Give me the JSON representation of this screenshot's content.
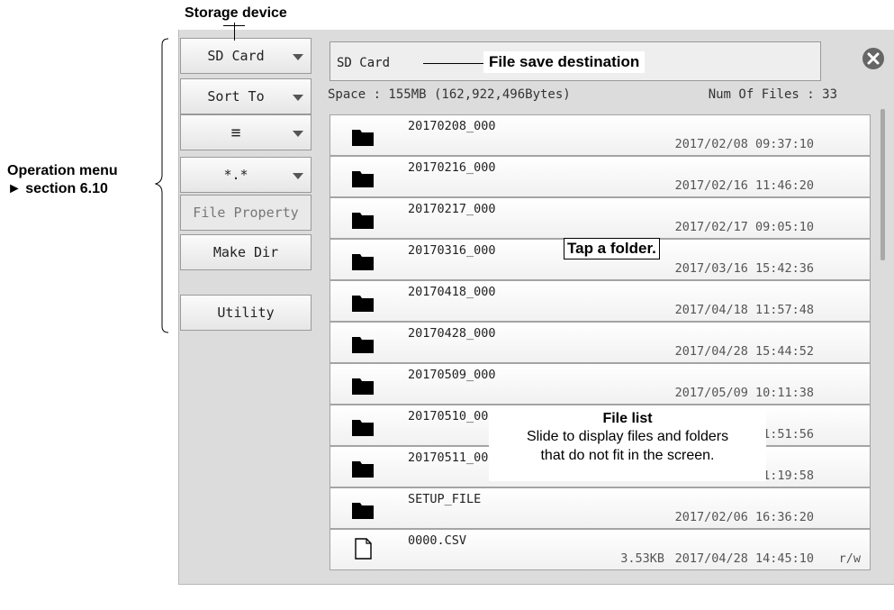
{
  "annotations": {
    "storage_device": "Storage device",
    "operation_menu_line1": "Operation menu",
    "operation_menu_line2": "► section 6.10",
    "file_save_destination": "File save destination",
    "tap_folder": "Tap a folder.",
    "file_list_title": "File list",
    "file_list_line1": "Slide to display files and folders",
    "file_list_line2": "that do not fit in the screen."
  },
  "menu": {
    "storage": "SD Card",
    "sort": "Sort To",
    "view": "≡",
    "filter": "*.*",
    "file_property": "File Property",
    "make_dir": "Make Dir",
    "utility": "Utility"
  },
  "destination": "SD Card",
  "space": "Space : 155MB (162,922,496Bytes)",
  "num_files": "Num Of Files : 33",
  "files": [
    {
      "name": "20170208_000",
      "date": "2017/02/08 09:37:10",
      "type": "folder"
    },
    {
      "name": "20170216_000",
      "date": "2017/02/16 11:46:20",
      "type": "folder"
    },
    {
      "name": "20170217_000",
      "date": "2017/02/17 09:05:10",
      "type": "folder"
    },
    {
      "name": "20170316_000",
      "date": "2017/03/16 15:42:36",
      "type": "folder"
    },
    {
      "name": "20170418_000",
      "date": "2017/04/18 11:57:48",
      "type": "folder"
    },
    {
      "name": "20170428_000",
      "date": "2017/04/28 15:44:52",
      "type": "folder"
    },
    {
      "name": "20170509_000",
      "date": "2017/05/09 10:11:38",
      "type": "folder"
    },
    {
      "name": "20170510_000",
      "date": "2017/05/10 11:51:56",
      "type": "folder"
    },
    {
      "name": "20170511_000",
      "date": "2017/05/11 11:19:58",
      "type": "folder"
    },
    {
      "name": "SETUP_FILE",
      "date": "2017/02/06 16:36:20",
      "type": "folder"
    },
    {
      "name": "0000.CSV",
      "date": "2017/04/28 14:45:10",
      "size": "3.53KB",
      "attr": "r/w",
      "type": "file"
    }
  ],
  "scroll_position": 0.0
}
